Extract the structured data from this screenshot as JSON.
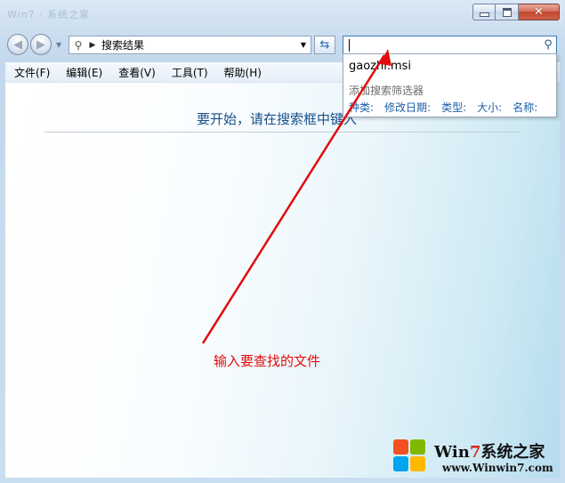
{
  "window": {
    "ghost_title": "Win7 · 系统之家",
    "caption": {
      "minimize": "‒",
      "close": "✕"
    }
  },
  "nav": {
    "address_text": "搜索结果",
    "search": {
      "value": "",
      "placeholder": ""
    }
  },
  "menubar": {
    "items": [
      "文件(F)",
      "编辑(E)",
      "查看(V)",
      "工具(T)",
      "帮助(H)"
    ]
  },
  "content": {
    "hint": "要开始，请在搜索框中键入"
  },
  "dropdown": {
    "suggestion": "gaozhi.msi",
    "filter_title": "添加搜索筛选器",
    "filters": [
      "种类:",
      "修改日期:",
      "类型:",
      "大小:",
      "名称:"
    ]
  },
  "annotation": {
    "text": "输入要查找的文件",
    "color": "#e20b0b"
  },
  "watermark": {
    "brand_prefix": "Win",
    "brand_seven": "7",
    "brand_suffix": "系统之家",
    "url": "www.Winwin7.com"
  },
  "colors": {
    "link": "#1b5fa8",
    "hint": "#1a4f8b",
    "accent_border": "#3c7fb1"
  }
}
